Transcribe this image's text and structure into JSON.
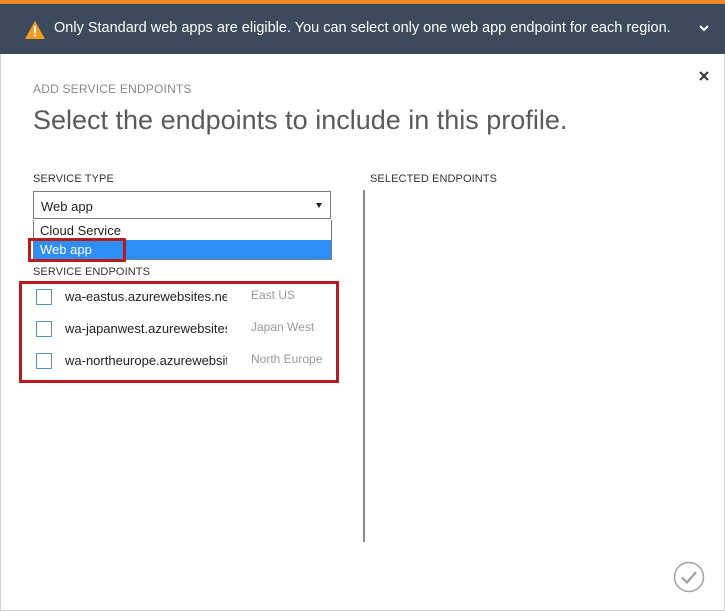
{
  "banner": {
    "message": "Only Standard web apps are eligible. You can select only one web app endpoint for each region.",
    "icon": "warning-icon",
    "accent_color": "#f08a24",
    "background": "#3c4a5c"
  },
  "dialog": {
    "eyebrow": "ADD SERVICE ENDPOINTS",
    "title": "Select the endpoints to include in this profile."
  },
  "service_type": {
    "label": "SERVICE TYPE",
    "selected": "Web app",
    "options": [
      "Cloud Service",
      "Web app"
    ]
  },
  "service_endpoints": {
    "label": "SERVICE ENDPOINTS",
    "items": [
      {
        "name": "wa-eastus.azurewebsites.net",
        "region": "East US",
        "checked": false
      },
      {
        "name": "wa-japanwest.azurewebsites.net",
        "region": "Japan West",
        "checked": false
      },
      {
        "name": "wa-northeurope.azurewebsites.net",
        "region": "North Europe",
        "checked": false
      }
    ]
  },
  "selected_endpoints": {
    "label": "SELECTED ENDPOINTS"
  },
  "colors": {
    "highlight": "#b71c1c",
    "selection": "#2f8ef5"
  }
}
